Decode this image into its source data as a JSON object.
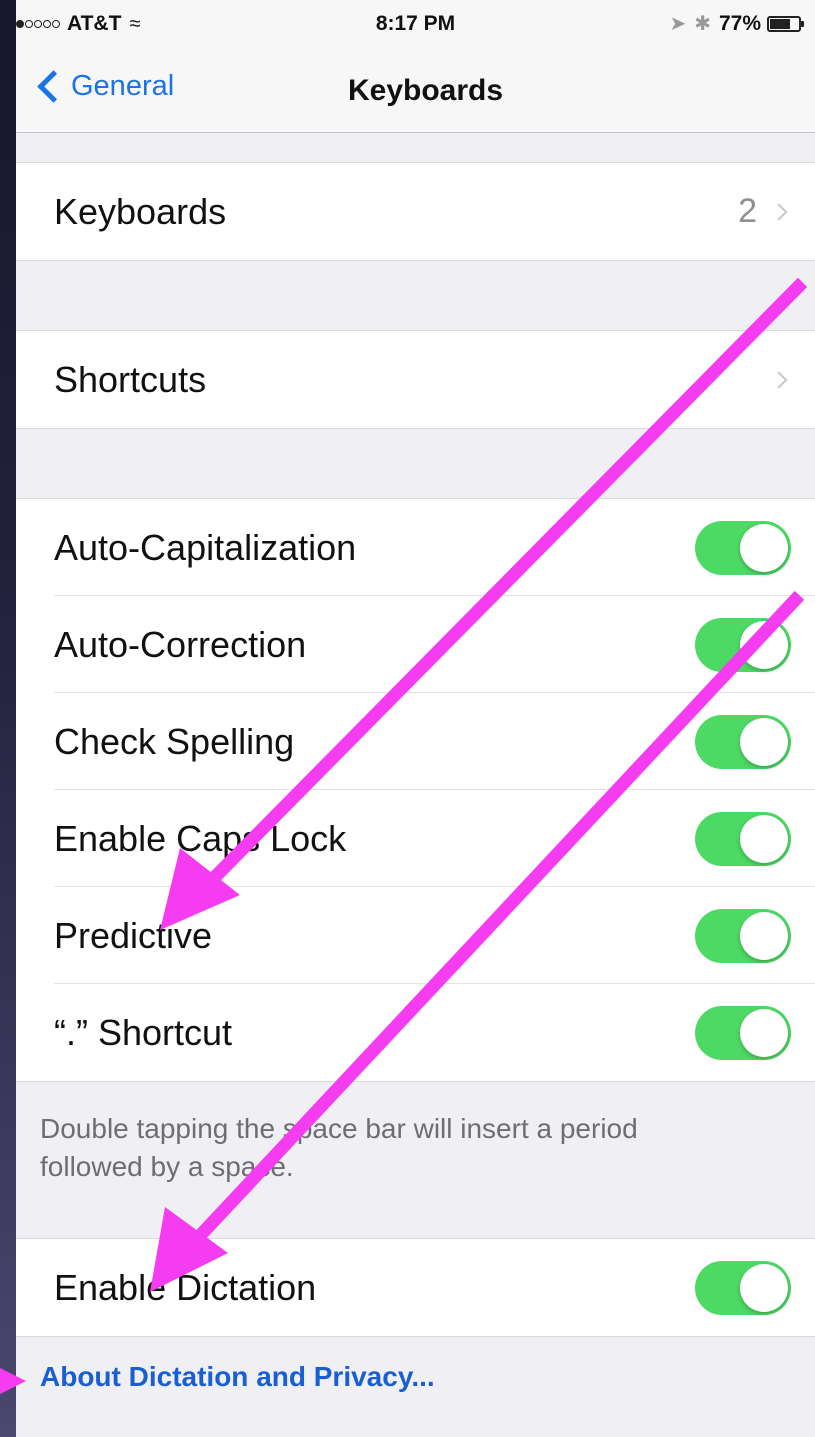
{
  "status_bar": {
    "carrier": "AT&T",
    "time": "8:17 PM",
    "battery": "77%",
    "battery_level": 0.77
  },
  "nav": {
    "back_label": "General",
    "title": "Keyboards"
  },
  "keyboards_row": {
    "label": "Keyboards",
    "value": "2"
  },
  "shortcuts_row": {
    "label": "Shortcuts"
  },
  "toggles": [
    {
      "label": "Auto-Capitalization",
      "on": true
    },
    {
      "label": "Auto-Correction",
      "on": true
    },
    {
      "label": "Check Spelling",
      "on": true
    },
    {
      "label": "Enable Caps Lock",
      "on": true
    },
    {
      "label": "Predictive",
      "on": true
    },
    {
      "label": "“.” Shortcut",
      "on": true
    }
  ],
  "shortcut_footer": "Double tapping the space bar will insert a period followed by a space.",
  "dictation_row": {
    "label": "Enable Dictation",
    "on": true
  },
  "privacy_link": "About Dictation and Privacy...",
  "colors": {
    "toggle_on": "#4cd964",
    "link_blue": "#1a73e8",
    "annotation_arrow": "#f53cf0"
  }
}
